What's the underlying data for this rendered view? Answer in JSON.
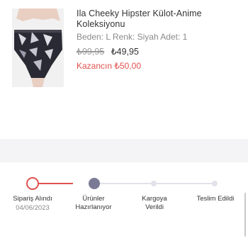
{
  "product": {
    "name": "Ila Cheeky Hipster Külot-Anime Koleksiyonu",
    "details": "Beden: L Renk: Siyah Adet: 1",
    "price_old": "₺99,95",
    "price_new": "₺49,95",
    "savings": "Kazancın ₺50,00"
  },
  "tracker": {
    "steps": [
      {
        "label": "Sipariş Alındı",
        "date": "04/06/2023",
        "status": "completed"
      },
      {
        "label": "Ürünler Hazırlanıyor",
        "status": "current"
      },
      {
        "label": "Kargoya Verildi",
        "status": "pending"
      },
      {
        "label": "Teslim Edildi",
        "status": "pending"
      }
    ]
  },
  "colors": {
    "accent": "#e0524f",
    "current_step": "#7b7a96",
    "pending": "#e2e2ea",
    "divider": "#f4f4f7"
  }
}
